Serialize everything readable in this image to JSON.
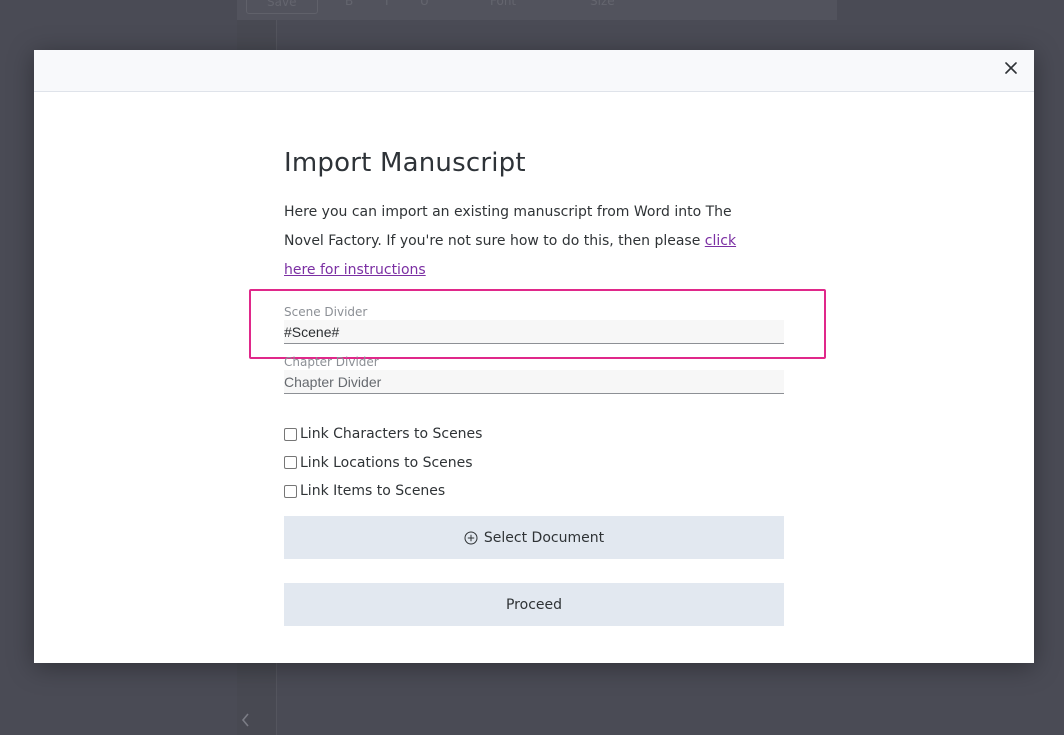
{
  "background": {
    "toolbar_save_label": "Save",
    "toolbar_font_label": "Font",
    "toolbar_size_label": "Size"
  },
  "modal": {
    "title": "Import Manuscript",
    "intro_text": "Here you can import an existing manuscript from Word into The Novel Factory. If you're not sure how to do this, then please ",
    "intro_link": "click here for instructions",
    "scene_divider": {
      "label": "Scene Divider",
      "value": "#Scene#"
    },
    "chapter_divider": {
      "label": "Chapter Divider",
      "placeholder": "Chapter Divider",
      "value": ""
    },
    "checkboxes": [
      {
        "label": "Link Characters to Scenes",
        "checked": false
      },
      {
        "label": "Link Locations to Scenes",
        "checked": false
      },
      {
        "label": "Link Items to Scenes",
        "checked": false
      }
    ],
    "select_document_label": "Select Document",
    "proceed_label": "Proceed"
  },
  "colors": {
    "accent_link": "#7b2fa3",
    "highlight_border": "#e0288a",
    "button_bg": "#e2e8f0"
  },
  "icons": {
    "close": "close-icon",
    "add": "plus-circle-icon",
    "back": "chevron-left-icon"
  }
}
